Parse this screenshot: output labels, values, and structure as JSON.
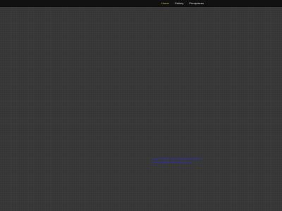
{
  "nav": {
    "items": [
      {
        "label": "Home",
        "active": true
      },
      {
        "label": "Gallery",
        "active": false
      },
      {
        "label": "Preciplaces",
        "active": false
      }
    ]
  },
  "footer_links": [
    {
      "text": "www.example-link-footer-photography.com"
    },
    {
      "text": "www.example-link-footer-2.com"
    }
  ],
  "colors": {
    "background": "#3a3a3a",
    "topbar": "#111111",
    "nav_active": "#c8b25a",
    "nav_text": "#d8d8d8",
    "link": "#2a2ad8"
  }
}
